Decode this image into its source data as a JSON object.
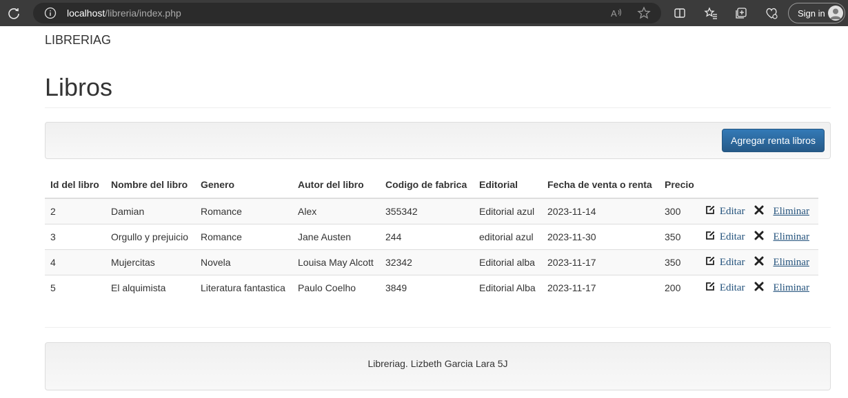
{
  "browser": {
    "url_host": "localhost",
    "url_path": "/libreria/index.php",
    "signin_label": "Sign in"
  },
  "navbar": {
    "brand": "LIBRERIAG"
  },
  "page": {
    "title": "Libros",
    "add_button_label": "Agregar renta libros"
  },
  "table": {
    "headers": [
      "Id del libro",
      "Nombre del libro",
      "Genero",
      "Autor del libro",
      "Codigo de fabrica",
      "Editorial",
      "Fecha de venta o renta",
      "Precio"
    ],
    "rows": [
      {
        "id": "2",
        "nombre": "Damian",
        "genero": "Romance",
        "autor": "Alex",
        "codigo": "355342",
        "editorial": "Editorial azul",
        "fecha": "2023-11-14",
        "precio": "300"
      },
      {
        "id": "3",
        "nombre": "Orgullo y prejuicio",
        "genero": "Romance",
        "autor": "Jane Austen",
        "codigo": "244",
        "editorial": "editorial azul",
        "fecha": "2023-11-30",
        "precio": "350"
      },
      {
        "id": "4",
        "nombre": "Mujercitas",
        "genero": "Novela",
        "autor": "Louisa May Alcott",
        "codigo": "32342",
        "editorial": "Editorial alba",
        "fecha": "2023-11-17",
        "precio": "350"
      },
      {
        "id": "5",
        "nombre": "El alquimista",
        "genero": "Literatura fantastica",
        "autor": "Paulo Coelho",
        "codigo": "3849",
        "editorial": "Editorial Alba",
        "fecha": "2023-11-17",
        "precio": "200"
      }
    ],
    "edit_label": "Editar",
    "delete_label": "Eliminar"
  },
  "footer": {
    "text": "Libreriag. Lizbeth Garcia Lara 5J"
  },
  "colors": {
    "primary": "#337ab7",
    "link": "#23527c",
    "chrome": "#3b3b3b"
  },
  "icons": [
    "reload-icon",
    "info-icon",
    "read-aloud-icon",
    "favorite-star-icon",
    "split-screen-icon",
    "favorites-icon",
    "collections-icon",
    "browser-essentials-icon",
    "avatar-icon",
    "edit-icon",
    "remove-icon"
  ]
}
